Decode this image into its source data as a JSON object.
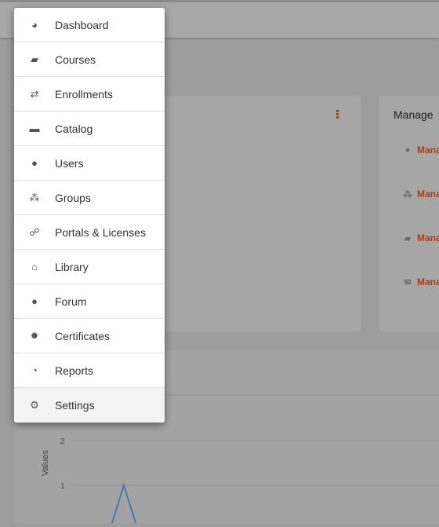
{
  "menu": {
    "items": [
      {
        "label": "Dashboard",
        "icon": "dashboard-gauge-icon",
        "glyph": "◕"
      },
      {
        "label": "Courses",
        "icon": "book-icon",
        "glyph": "▰"
      },
      {
        "label": "Enrollments",
        "icon": "exchange-arrows-icon",
        "glyph": "⇄"
      },
      {
        "label": "Catalog",
        "icon": "folder-icon",
        "glyph": "▬"
      },
      {
        "label": "Users",
        "icon": "user-icon",
        "glyph": "●"
      },
      {
        "label": "Groups",
        "icon": "users-group-icon",
        "glyph": "⁂"
      },
      {
        "label": "Portals & Licenses",
        "icon": "sitemap-icon",
        "glyph": "☍"
      },
      {
        "label": "Library",
        "icon": "bank-icon",
        "glyph": "⌂"
      },
      {
        "label": "Forum",
        "icon": "comment-icon",
        "glyph": "●"
      },
      {
        "label": "Certificates",
        "icon": "certificate-icon",
        "glyph": "✹"
      },
      {
        "label": "Reports",
        "icon": "pie-chart-icon",
        "glyph": "◔"
      },
      {
        "label": "Settings",
        "icon": "gear-icon",
        "glyph": "⚙"
      }
    ],
    "selected": "Settings"
  },
  "manage": {
    "title": "Manage",
    "rows": [
      {
        "label": "Mana",
        "icon": "user-icon",
        "glyph": "●"
      },
      {
        "label": "Mana",
        "icon": "users-group-icon",
        "glyph": "⁂"
      },
      {
        "label": "Mana",
        "icon": "book-icon",
        "glyph": "▰"
      },
      {
        "label": "Mana",
        "icon": "envelope-icon",
        "glyph": "✉"
      }
    ]
  },
  "colors": {
    "accent": "#b23c14",
    "line": "#4a78a8"
  },
  "chart_data": {
    "type": "line",
    "ylabel": "Values",
    "yticks": [
      1,
      2
    ],
    "series": [
      {
        "values": [
          0,
          1,
          0
        ]
      }
    ]
  }
}
